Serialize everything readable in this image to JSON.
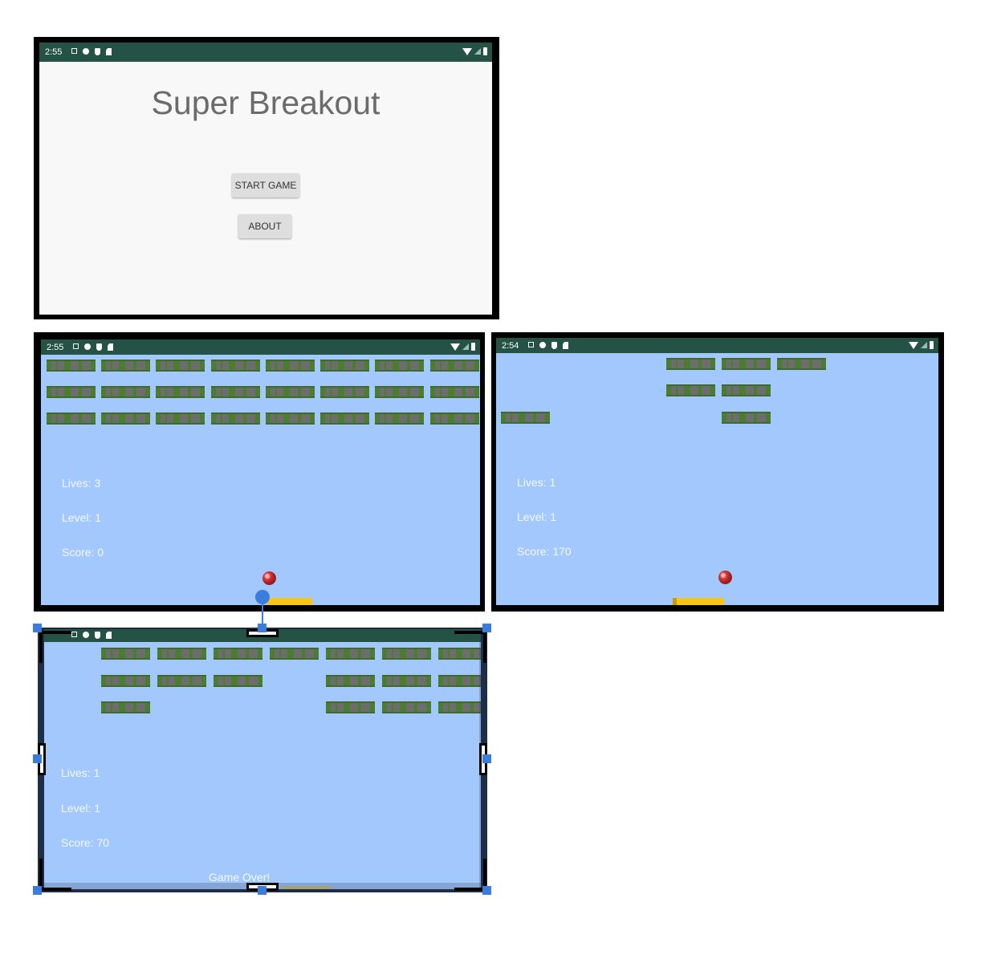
{
  "menu_screen": {
    "time": "2:55",
    "title": "Super Breakout",
    "start_button": "START GAME",
    "about_button": "ABOUT"
  },
  "game_screen_1": {
    "time": "2:55",
    "lives": "Lives: 3",
    "level": "Level: 1",
    "score": "Score: 0"
  },
  "game_screen_2": {
    "time": "2:54",
    "lives": "Lives: 1",
    "level": "Level: 1",
    "score": "Score: 170"
  },
  "game_screen_3": {
    "lives": "Lives: 1",
    "level": "Level: 1",
    "score": "Score: 70",
    "game_over": "Game Over!"
  },
  "colors": {
    "status_bar": "#245244",
    "game_background": "#a3c8fd",
    "menu_background": "#f8f8f8",
    "paddle": "#f5c518",
    "selection": "#3b7ddd"
  },
  "icons": [
    "notification-icon",
    "gear-icon",
    "shield-icon",
    "sd-card-icon",
    "wifi-icon",
    "signal-icon",
    "battery-icon"
  ]
}
